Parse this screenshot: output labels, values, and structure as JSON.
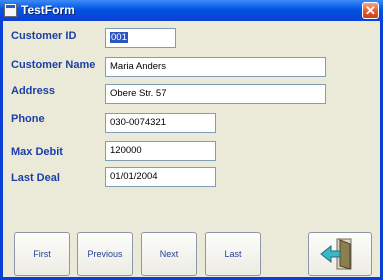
{
  "window": {
    "title": "TestForm",
    "close_glyph": "✕"
  },
  "fields": {
    "customer_id": {
      "label": "Customer ID",
      "value": "001"
    },
    "customer_name": {
      "label": "Customer Name",
      "value": "Maria Anders"
    },
    "address": {
      "label": "Address",
      "value": "Obere Str. 57"
    },
    "phone": {
      "label": "Phone",
      "value": "030-0074321"
    },
    "max_debit": {
      "label": "Max Debit",
      "value": "120000"
    },
    "last_deal": {
      "label": "Last Deal",
      "value": "01/01/2004"
    }
  },
  "buttons": {
    "first": "First",
    "previous": "Previous",
    "next": "Next",
    "last": "Last"
  },
  "icons": {
    "app": "form-icon",
    "exit": "exit-door-icon"
  },
  "colors": {
    "label": "#1a3fa8",
    "titlebar": "#0054e3",
    "close": "#e35a33",
    "background": "#ebe9d8",
    "exit_arrow": "#3ab6c4"
  }
}
